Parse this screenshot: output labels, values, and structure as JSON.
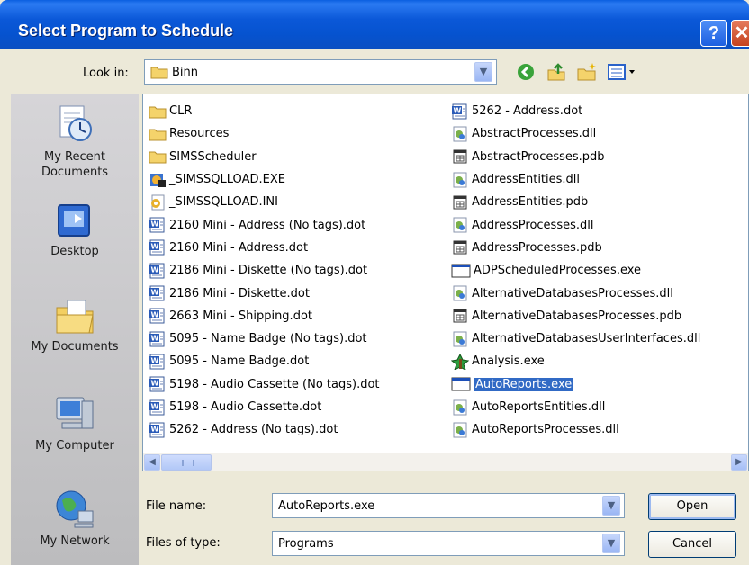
{
  "window": {
    "title": "Select Program to Schedule",
    "help_glyph": "?",
    "close_glyph": "✕"
  },
  "look_in": {
    "label": "Look in:",
    "value": "Binn"
  },
  "places": [
    {
      "label": "My Recent Documents",
      "icon": "recent-documents-icon"
    },
    {
      "label": "Desktop",
      "icon": "desktop-icon"
    },
    {
      "label": "My Documents",
      "icon": "my-documents-icon"
    },
    {
      "label": "My Computer",
      "icon": "my-computer-icon"
    },
    {
      "label": "My Network",
      "icon": "my-network-icon"
    }
  ],
  "files_col1": [
    {
      "name": "CLR",
      "type": "folder"
    },
    {
      "name": "Resources",
      "type": "folder"
    },
    {
      "name": "SIMSScheduler",
      "type": "folder"
    },
    {
      "name": "_SIMSSQLLOAD.EXE",
      "type": "exe"
    },
    {
      "name": "_SIMSSQLLOAD.INI",
      "type": "ini"
    },
    {
      "name": "2160 Mini - Address (No tags).dot",
      "type": "dot"
    },
    {
      "name": "2160 Mini - Address.dot",
      "type": "dot"
    },
    {
      "name": "2186 Mini - Diskette (No tags).dot",
      "type": "dot"
    },
    {
      "name": "2186 Mini - Diskette.dot",
      "type": "dot"
    },
    {
      "name": "2663 Mini - Shipping.dot",
      "type": "dot"
    },
    {
      "name": "5095 - Name Badge (No tags).dot",
      "type": "dot"
    },
    {
      "name": "5095 - Name Badge.dot",
      "type": "dot"
    },
    {
      "name": "5198 - Audio Cassette (No tags).dot",
      "type": "dot"
    },
    {
      "name": "5198 - Audio Cassette.dot",
      "type": "dot"
    },
    {
      "name": "5262 - Address (No tags).dot",
      "type": "dot"
    }
  ],
  "files_col2": [
    {
      "name": "5262 - Address.dot",
      "type": "dot"
    },
    {
      "name": "AbstractProcesses.dll",
      "type": "dll"
    },
    {
      "name": "AbstractProcesses.pdb",
      "type": "pdb"
    },
    {
      "name": "AddressEntities.dll",
      "type": "dll"
    },
    {
      "name": "AddressEntities.pdb",
      "type": "pdb"
    },
    {
      "name": "AddressProcesses.dll",
      "type": "dll"
    },
    {
      "name": "AddressProcesses.pdb",
      "type": "pdb"
    },
    {
      "name": "ADPScheduledProcesses.exe",
      "type": "app"
    },
    {
      "name": "AlternativeDatabasesProcesses.dll",
      "type": "dll"
    },
    {
      "name": "AlternativeDatabasesProcesses.pdb",
      "type": "pdb"
    },
    {
      "name": "AlternativeDatabasesUserInterfaces.dll",
      "type": "dll"
    },
    {
      "name": "Analysis.exe",
      "type": "analysis"
    },
    {
      "name": "AutoReports.exe",
      "type": "app",
      "selected": true
    },
    {
      "name": "AutoReportsEntities.dll",
      "type": "dll"
    },
    {
      "name": "AutoReportsProcesses.dll",
      "type": "dll"
    }
  ],
  "file_name": {
    "label": "File name:",
    "value": "AutoReports.exe"
  },
  "file_type": {
    "label": "Files of type:",
    "value": "Programs"
  },
  "buttons": {
    "open": "Open",
    "cancel": "Cancel"
  },
  "colors": {
    "titlebar": "#0b58d8",
    "selection": "#316ac5",
    "face": "#ece9d8"
  }
}
